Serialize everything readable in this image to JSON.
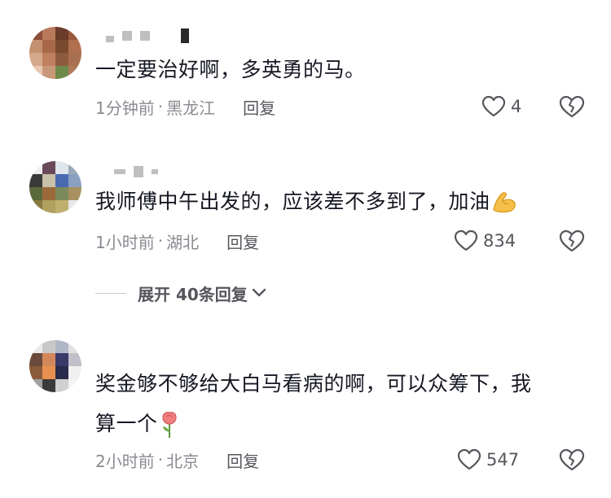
{
  "comments": [
    {
      "text": "一定要治好啊，多英勇的马。",
      "time": "1分钟前",
      "location": "黑龙江",
      "reply_label": "回复",
      "likes": "4",
      "avatar_colors": [
        "#8a4e3a",
        "#b87a5a",
        "#6a3a2a",
        "#9a5a3a",
        "#c49070",
        "#a86848",
        "#7a4a30",
        "#b07050",
        "#d4a88a",
        "#c08060",
        "#8e5a3e",
        "#a87050",
        "#e8c8b0",
        "#c89878",
        "#6e8a4a",
        "#b07a58"
      ],
      "icons": [
        "heart-outline-icon",
        "broken-heart-icon"
      ]
    },
    {
      "text": "我师傅中午出发的，应该差不多到了，加油",
      "emoji": "flexed-biceps-emoji",
      "time": "1小时前",
      "location": "湖北",
      "reply_label": "回复",
      "likes": "834",
      "expand_label": "展开 40条回复",
      "avatar_colors": [
        "#f0f0f0",
        "#6a4a5a",
        "#dfe6ec",
        "#9aa8b8",
        "#3a3a3a",
        "#c8c0a8",
        "#4a6ab0",
        "#8aa0c0",
        "#5a6a3a",
        "#9a6a3a",
        "#7a8a5a",
        "#a89060",
        "#8a7a40",
        "#b0a060",
        "#c0b070",
        "#e8e8e8"
      ],
      "icons": [
        "heart-outline-icon",
        "broken-heart-icon",
        "chevron-down-icon"
      ]
    },
    {
      "text_line1": "奖金够不够给大白马看病的啊，可以众筹下，我",
      "text_line2": "算一个",
      "emoji": "rose-emoji",
      "time": "2小时前",
      "location": "北京",
      "reply_label": "回复",
      "likes": "547",
      "avatar_colors": [
        "#e8e8e8",
        "#c8c8c8",
        "#b0b8c8",
        "#e0e0e0",
        "#6a4a3a",
        "#d4885a",
        "#3a3a6a",
        "#c0c0c8",
        "#8a5a3a",
        "#e89050",
        "#2a2a4a",
        "#f0f0f0",
        "#a0a0a0",
        "#3a3a3a",
        "#d0d0d0",
        "#f4f4f4"
      ],
      "icons": [
        "heart-outline-icon",
        "broken-heart-icon"
      ]
    }
  ],
  "separator": "·"
}
